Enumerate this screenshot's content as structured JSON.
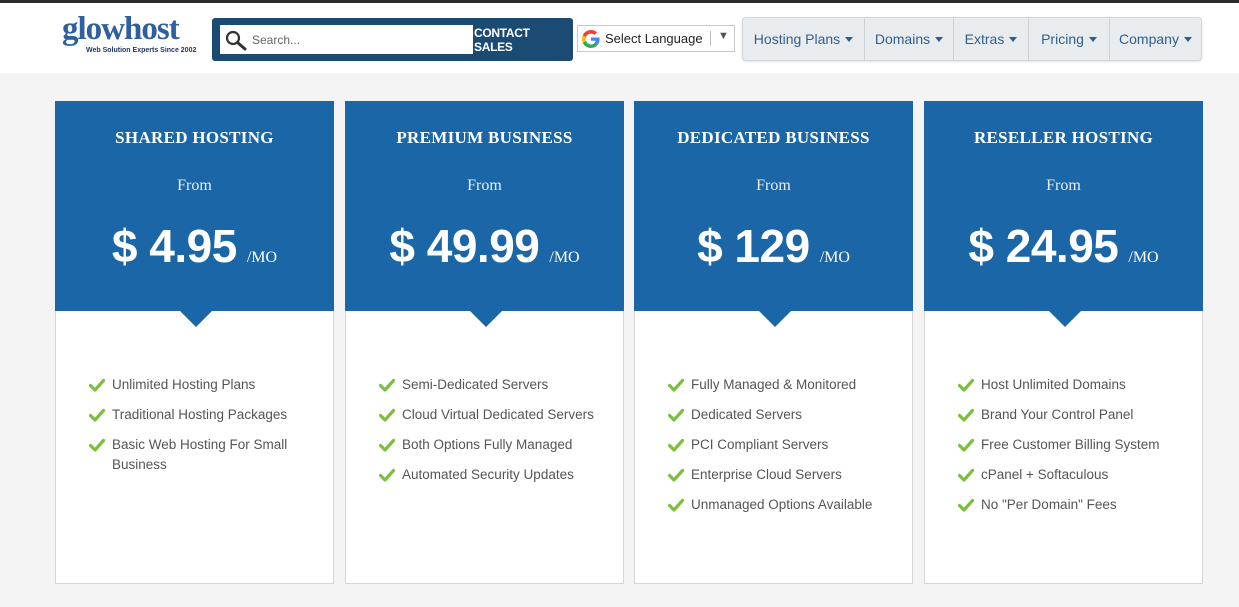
{
  "header": {
    "logo": {
      "text": "glowhost",
      "tagline": "Web Solution Experts Since 2002"
    },
    "search": {
      "placeholder": "Search...",
      "icon": "search-icon"
    },
    "contact_sales_label": "CONTACT SALES",
    "language": {
      "label": "Select Language",
      "arrow": "▼",
      "icon": "google-g-icon"
    },
    "nav": [
      {
        "label": "Hosting Plans",
        "width": 122
      },
      {
        "label": "Domains",
        "width": 89
      },
      {
        "label": "Extras",
        "width": 75
      },
      {
        "label": "Pricing",
        "width": 81
      },
      {
        "label": "Company",
        "width": 91
      }
    ]
  },
  "plans": [
    {
      "title": "SHARED HOSTING",
      "from": "From",
      "price": "$ 4.95",
      "unit": "/MO",
      "features": [
        "Unlimited Hosting Plans",
        "Traditional Hosting Packages",
        "Basic Web Hosting For Small Business"
      ]
    },
    {
      "title": "PREMIUM BUSINESS",
      "from": "From",
      "price": "$ 49.99",
      "unit": "/MO",
      "features": [
        "Semi-Dedicated Servers",
        "Cloud Virtual Dedicated Servers",
        "Both Options Fully Managed",
        "Automated Security Updates"
      ]
    },
    {
      "title": "DEDICATED BUSINESS",
      "from": "From",
      "price": "$ 129",
      "unit": "/MO",
      "features": [
        "Fully Managed & Monitored",
        "Dedicated Servers",
        "PCI Compliant Servers",
        "Enterprise Cloud Servers",
        "Unmanaged Options Available"
      ]
    },
    {
      "title": "RESELLER HOSTING",
      "from": "From",
      "price": "$ 24.95",
      "unit": "/MO",
      "features": [
        "Host Unlimited Domains",
        "Brand Your Control Panel",
        "Free Customer Billing System",
        "cPanel + Softaculous",
        "No \"Per Domain\" Fees"
      ]
    }
  ],
  "colors": {
    "primary_blue": "#1a66a6",
    "header_navy": "#1b4a73",
    "check_green": "#7cbf3f",
    "nav_text": "#2f5f8e"
  }
}
